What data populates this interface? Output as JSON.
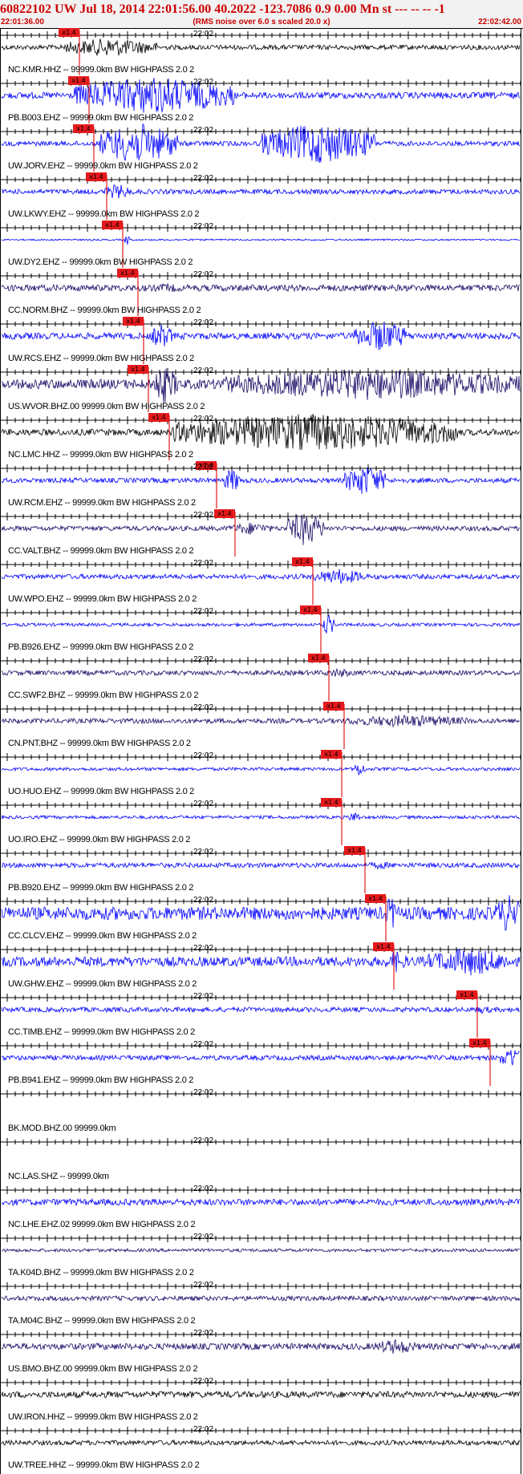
{
  "header": {
    "title": "60822102 UW Jul 18, 2014 22:01:56.00   40.2022 -123.7086  0.9 0.00 Mn st --- -- --  -1",
    "start_time": "22:01:36.00",
    "note": "(RMS noise over 6.0 s scaled 20.0 x)",
    "end_time": "22:02:42.00"
  },
  "colors": {
    "blue": "#0000ff",
    "black": "#000000",
    "navy": "#1a0a66",
    "pick": "#e41a1c"
  },
  "mid_tick_label": "22:02",
  "pick_label": "x1.4",
  "traces": [
    {
      "label": "NC.KMR.HHZ -- 99999.0km BW  HIGHPASS  2.0  2",
      "color": "black",
      "amp": [
        3,
        12,
        6
      ],
      "burst": [
        0.12,
        0.3
      ],
      "pick": 0.152
    },
    {
      "label": "PB.B003.EHZ -- 99999.0km BW  HIGHPASS  2.0  2",
      "color": "blue",
      "amp": [
        4,
        24,
        8
      ],
      "burst": [
        0.14,
        0.45
      ],
      "pick": 0.17
    },
    {
      "label": "UW.JORV.EHZ -- 99999.0km BW  HIGHPASS  2.0  2",
      "color": "blue",
      "amp": [
        3,
        26,
        26
      ],
      "burst": [
        0.19,
        0.34
      ],
      "burst2": [
        0.5,
        0.72
      ],
      "pick": 0.18
    },
    {
      "label": "UW.LKWY.EHZ -- 99999.0km BW  HIGHPASS  2.0  2",
      "color": "blue",
      "amp": [
        3,
        10,
        3
      ],
      "burst": [
        0.2,
        0.25
      ],
      "pick": 0.205
    },
    {
      "label": "UW.DY2.EHZ -- 99999.0km BW  HIGHPASS  2.0  2",
      "color": "blue",
      "amp": [
        1,
        8,
        1
      ],
      "burst": [
        0.24,
        0.25
      ],
      "pick": 0.235
    },
    {
      "label": "CC.NORM.BHZ -- 99999.0km BW  HIGHPASS  2.0  2",
      "color": "navy",
      "amp": [
        4,
        6,
        4
      ],
      "burst": [
        0.28,
        0.36
      ],
      "pick": 0.265
    },
    {
      "label": "UW.RCS.EHZ -- 99999.0km BW  HIGHPASS  2.0  2",
      "color": "blue",
      "amp": [
        4,
        16,
        20
      ],
      "burst": [
        0.29,
        0.33
      ],
      "burst2": [
        0.68,
        0.78
      ],
      "pick": 0.275
    },
    {
      "label": "US.WVOR.BHZ.00 99999.0km BW  HIGHPASS  2.0  2",
      "color": "navy",
      "amp": [
        6,
        24,
        20
      ],
      "burst": [
        0.29,
        0.34
      ],
      "burst2": [
        0.42,
        1.0
      ],
      "pick": 0.285
    },
    {
      "label": "NC.LMC.HHZ -- 99999.0km BW  HIGHPASS  2.0  2",
      "color": "black",
      "amp": [
        4,
        24,
        16
      ],
      "burst": [
        0.33,
        0.88
      ],
      "pick": 0.325
    },
    {
      "label": "UW.RCM.EHZ -- 99999.0km BW  HIGHPASS  2.0  2",
      "color": "blue",
      "amp": [
        3,
        16,
        20
      ],
      "burst": [
        0.43,
        0.46
      ],
      "burst2": [
        0.66,
        0.74
      ],
      "pick": 0.415
    },
    {
      "label": "CC.VALT.BHZ -- 99999.0km BW  HIGHPASS  2.0  2",
      "color": "navy",
      "amp": [
        3,
        8,
        22
      ],
      "burst": [
        0.44,
        0.52
      ],
      "burst2": [
        0.55,
        0.62
      ],
      "pick": 0.45
    },
    {
      "label": "UW.WPO.EHZ -- 99999.0km BW  HIGHPASS  2.0  2",
      "color": "blue",
      "amp": [
        3,
        10,
        3
      ],
      "burst": [
        0.6,
        0.7
      ],
      "pick": 0.6
    },
    {
      "label": "PB.B926.EHZ -- 99999.0km BW  HIGHPASS  2.0  2",
      "color": "blue",
      "amp": [
        2,
        14,
        2
      ],
      "burst": [
        0.62,
        0.64
      ],
      "pick": 0.615
    },
    {
      "label": "CC.SWF2.BHZ -- 99999.0km BW  HIGHPASS  2.0  2",
      "color": "navy",
      "amp": [
        3,
        6,
        3
      ],
      "burst": [
        0.62,
        0.68
      ],
      "pick": 0.63
    },
    {
      "label": "CN.PNT.BHZ -- 99999.0km BW  HIGHPASS  2.0  2",
      "color": "navy",
      "amp": [
        3,
        8,
        3
      ],
      "burst": [
        0.66,
        0.9
      ],
      "pick": 0.66
    },
    {
      "label": "UO.HUO.EHZ -- 99999.0km BW  HIGHPASS  2.0  2",
      "color": "blue",
      "amp": [
        2,
        10,
        2
      ],
      "burst": [
        0.68,
        0.7
      ],
      "pick": 0.655
    },
    {
      "label": "UO.IRO.EHZ -- 99999.0km BW  HIGHPASS  2.0  2",
      "color": "blue",
      "amp": [
        2,
        8,
        2
      ],
      "burst": [
        0.67,
        0.69
      ],
      "pick": 0.655
    },
    {
      "label": "PB.B920.EHZ -- 99999.0km BW  HIGHPASS  2.0  2",
      "color": "blue",
      "amp": [
        3,
        5,
        3
      ],
      "burst": [
        0.7,
        0.76
      ],
      "pick": 0.7
    },
    {
      "label": "CC.CLCV.EHZ -- 99999.0km BW  HIGHPASS  2.0  2",
      "color": "blue",
      "amp": [
        8,
        24,
        24
      ],
      "burst": [
        0.74,
        0.76
      ],
      "burst2": [
        0.95,
        1.0
      ],
      "pick": 0.74
    },
    {
      "label": "UW.GHW.EHZ -- 99999.0km BW  HIGHPASS  2.0  2",
      "color": "blue",
      "amp": [
        6,
        14,
        18
      ],
      "burst": [
        0.74,
        0.78
      ],
      "burst2": [
        0.82,
        0.98
      ],
      "pick": 0.755
    },
    {
      "label": "CC.TIMB.EHZ -- 99999.0km BW  HIGHPASS  2.0  2",
      "color": "blue",
      "amp": [
        3,
        5,
        3
      ],
      "burst": [
        0.9,
        0.95
      ],
      "pick": 0.915
    },
    {
      "label": "PB.B941.EHZ -- 99999.0km BW  HIGHPASS  2.0  2",
      "color": "blue",
      "amp": [
        3,
        14,
        3
      ],
      "burst": [
        0.96,
        1.0
      ],
      "pick": 0.94
    },
    {
      "label": "BK.MOD.BHZ.00 99999.0km",
      "color": "blue",
      "amp": [
        0,
        0,
        0
      ],
      "burst": [
        0,
        0
      ],
      "pick": null
    },
    {
      "label": "NC.LAS.SHZ -- 99999.0km",
      "color": "blue",
      "amp": [
        0,
        0,
        0
      ],
      "burst": [
        0,
        0
      ],
      "pick": null
    },
    {
      "label": "NC.LHE.EHZ.02 99999.0km BW  HIGHPASS  2.0  2",
      "color": "blue",
      "amp": [
        4,
        4,
        4
      ],
      "burst": [
        0,
        0
      ],
      "pick": null
    },
    {
      "label": "TA.K04D.BHZ -- 99999.0km BW  HIGHPASS  2.0  2",
      "color": "navy",
      "amp": [
        2,
        2,
        2
      ],
      "burst": [
        0,
        0
      ],
      "pick": null
    },
    {
      "label": "TA.M04C.BHZ -- 99999.0km BW  HIGHPASS  2.0  2",
      "color": "navy",
      "amp": [
        3,
        3,
        3
      ],
      "burst": [
        0,
        0
      ],
      "pick": null
    },
    {
      "label": "US.BMO.BHZ.00 99999.0km BW  HIGHPASS  2.0  2",
      "color": "navy",
      "amp": [
        4,
        10,
        4
      ],
      "burst": [
        0.72,
        0.8
      ],
      "pick": null
    },
    {
      "label": "UW.IRON.HHZ -- 99999.0km BW  HIGHPASS  2.0  2",
      "color": "black",
      "amp": [
        4,
        4,
        4
      ],
      "burst": [
        0,
        0
      ],
      "pick": null
    },
    {
      "label": "UW.TREE.HHZ -- 99999.0km BW  HIGHPASS  2.0  2",
      "color": "black",
      "amp": [
        3,
        3,
        3
      ],
      "burst": [
        0,
        0
      ],
      "pick": null
    }
  ]
}
